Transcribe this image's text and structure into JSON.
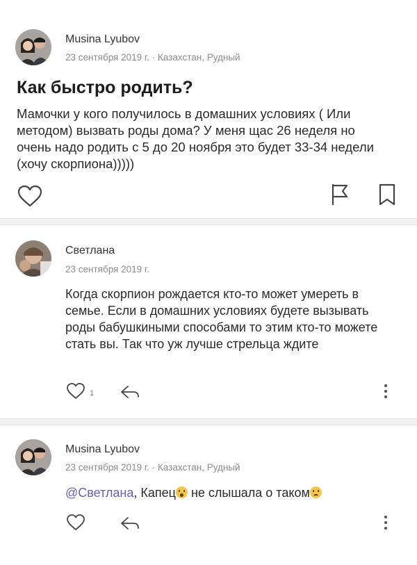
{
  "post": {
    "author": "Musina Lyubov",
    "meta": "23 сентября 2019 г. · Казахстан, Рудный",
    "title": "Как быстро родить?",
    "body": "Мамочки у кого получилось в домашних условиях ( Или методом) вызвать роды дома? У меня щас 26 неделя но очень надо родить с 5 до 20 ноября это будет 33-34 недели (хочу скорпиона)))))"
  },
  "comments": [
    {
      "author": "Светлана",
      "meta": "23 сентября 2019 г.",
      "body": "Когда скорпион рождается кто-то может умереть в семье. Если в домашних условиях будете вызывать роды бабушкиными способами то этим кто-то можете стать вы. Так что уж лучше стрельца ждите",
      "likes": "1"
    },
    {
      "author": "Musina Lyubov",
      "meta": "23 сентября 2019 г. · Казахстан, Рудный",
      "mention": "@Светлана",
      "body_part1": ", Капец",
      "body_part2": " не слышала о таком"
    }
  ],
  "icons": {
    "like": "heart-icon",
    "report": "flag-icon",
    "save": "bookmark-icon",
    "reply": "reply-arrow-icon",
    "more": "more-vertical-icon"
  },
  "colors": {
    "mention": "#6a5fbf",
    "meta": "#8b8b8b",
    "divider": "#f2f2f2"
  }
}
